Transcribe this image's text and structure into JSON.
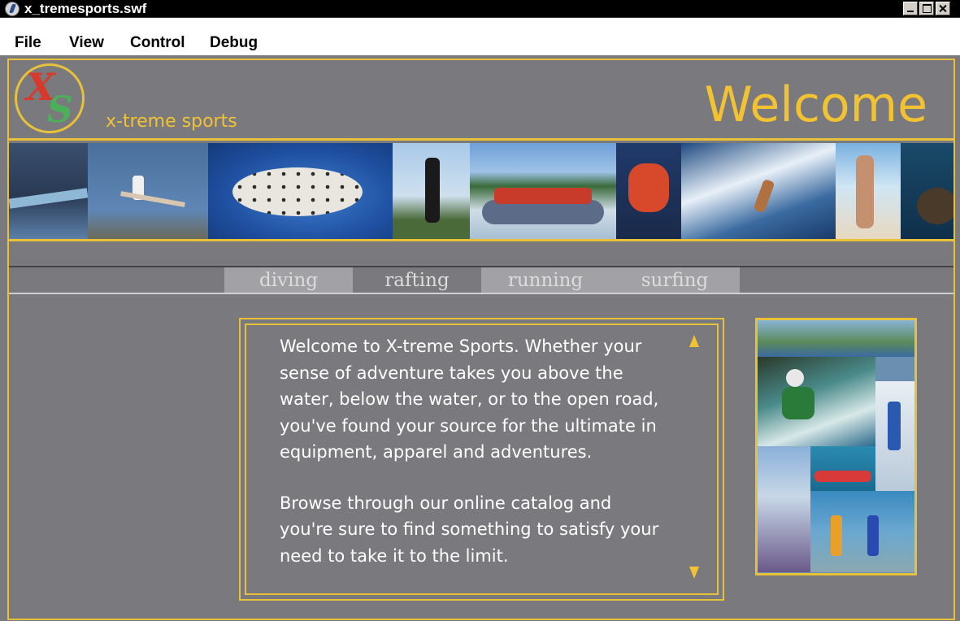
{
  "window": {
    "title": "x_tremesports.swf"
  },
  "menu": {
    "items": [
      "File",
      "View",
      "Control",
      "Debug"
    ]
  },
  "header": {
    "logo_x": "X",
    "logo_s": "S",
    "brand": "x-treme sports",
    "title": "Welcome"
  },
  "nav": {
    "tabs": [
      "diving",
      "rafting",
      "running",
      "surfing"
    ]
  },
  "content": {
    "paragraphs": [
      "Welcome to X-treme Sports. Whether your sense of adventure takes you above the water, below the water, or to the open road, you've found your source for the ultimate in equipment, apparel and adventures.",
      "Browse through our online catalog and you're sure to find something to satisfy your need to take it to the limit."
    ]
  },
  "colors": {
    "stage_bg": "#7a7a7e",
    "accent_gold": "#e8c13a",
    "text_gold": "#f2c233",
    "logo_red": "#d9392a",
    "logo_green": "#4bb05a"
  },
  "icons": {
    "app": "flash-player-icon",
    "scroll_up": "triangle-up-icon",
    "scroll_down": "triangle-down-icon"
  }
}
